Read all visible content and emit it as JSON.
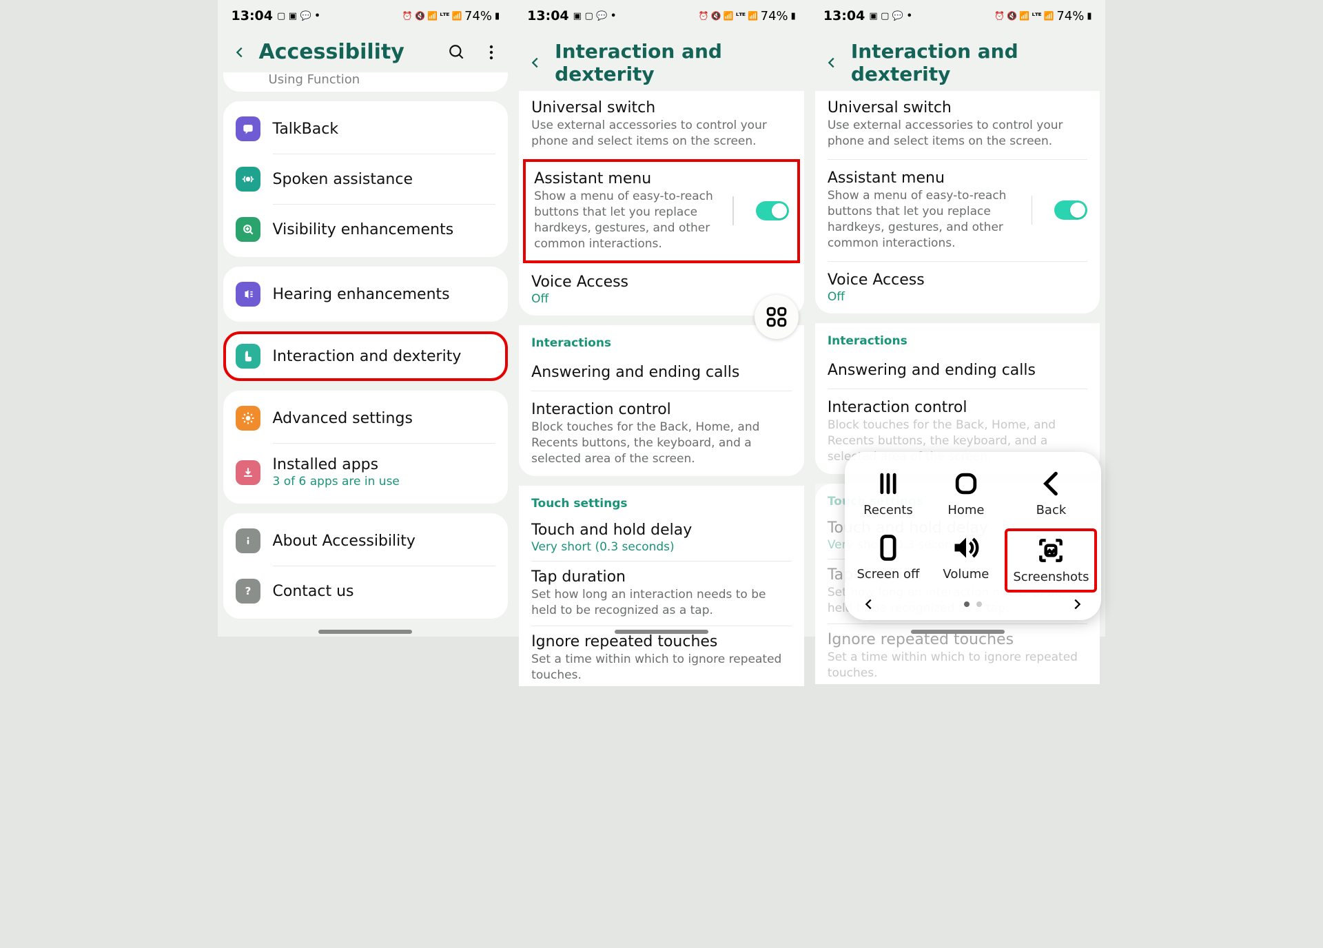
{
  "status": {
    "time": "13:04",
    "battery_text": "74%"
  },
  "colors": {
    "accent": "#136356",
    "toggle_on": "#2bd4b0",
    "highlight": "#e60000"
  },
  "screens": [
    {
      "title": "Accessibility",
      "peek_text": "Using Function",
      "groups": [
        {
          "items": [
            {
              "icon_color": "#6f5bd4",
              "icon": "chat",
              "title": "TalkBack"
            },
            {
              "icon_color": "#1fa38f",
              "icon": "voice",
              "title": "Spoken assistance"
            },
            {
              "icon_color": "#2ba36c",
              "icon": "zoom",
              "title": "Visibility enhancements"
            }
          ]
        },
        {
          "items": [
            {
              "icon_color": "#6f5bd4",
              "icon": "hear",
              "title": "Hearing enhancements"
            }
          ]
        },
        {
          "items": [
            {
              "icon_color": "#2bb29a",
              "icon": "touch",
              "title": "Interaction and dexterity",
              "highlighted": true
            }
          ]
        },
        {
          "items": [
            {
              "icon_color": "#f08c2b",
              "icon": "gear",
              "title": "Advanced settings"
            },
            {
              "icon_color": "#e06a7b",
              "icon": "download",
              "title": "Installed apps",
              "sub_green": "3 of 6 apps are in use"
            }
          ]
        },
        {
          "items": [
            {
              "icon_color": "#8b8f8c",
              "icon": "info",
              "title": "About Accessibility"
            },
            {
              "icon_color": "#8b8f8c",
              "icon": "help",
              "title": "Contact us"
            }
          ]
        }
      ]
    },
    {
      "title": "Interaction and dexterity",
      "sections": [
        {
          "kind": "group",
          "items": [
            {
              "title": "Universal switch",
              "sub": "Use external accessories to control your phone and select items on the screen."
            },
            {
              "title": "Assistant menu",
              "sub": "Show a menu of easy-to-reach buttons that let you replace hardkeys, gestures, and other common interactions.",
              "toggle": true,
              "highlighted": true
            },
            {
              "title": "Voice Access",
              "sub_green": "Off"
            }
          ]
        },
        {
          "kind": "header",
          "label": "Interactions"
        },
        {
          "kind": "group",
          "items": [
            {
              "title": "Answering and ending calls"
            },
            {
              "title": "Interaction control",
              "sub": "Block touches for the Back, Home, and Recents buttons, the keyboard, and a selected area of the screen."
            }
          ]
        },
        {
          "kind": "header",
          "label": "Touch settings"
        },
        {
          "kind": "group",
          "items": [
            {
              "title": "Touch and hold delay",
              "sub_green": "Very short (0.3 seconds)"
            },
            {
              "title": "Tap duration",
              "sub": "Set how long an interaction needs to be held to be recognized as a tap."
            },
            {
              "title": "Ignore repeated touches",
              "sub": "Set a time within which to ignore repeated touches."
            }
          ]
        }
      ],
      "floating_button": true
    },
    {
      "title": "Interaction and dexterity",
      "sections": [
        {
          "kind": "group",
          "items": [
            {
              "title": "Universal switch",
              "sub": "Use external accessories to control your phone and select items on the screen."
            },
            {
              "title": "Assistant menu",
              "sub": "Show a menu of easy-to-reach buttons that let you replace hardkeys, gestures, and other common interactions.",
              "toggle": true
            },
            {
              "title": "Voice Access",
              "sub_green": "Off"
            }
          ]
        },
        {
          "kind": "header",
          "label": "Interactions"
        },
        {
          "kind": "group",
          "items": [
            {
              "title": "Answering and ending calls"
            },
            {
              "title": "Interaction control",
              "sub": "Block touches for the Back, Home, and Recents buttons, the keyboard, and a selected area of the screen."
            }
          ]
        },
        {
          "kind": "header",
          "label": "Touch settings"
        },
        {
          "kind": "group",
          "items": [
            {
              "title": "Touch and hold delay",
              "sub_green": "Very short (0.3 seconds)"
            },
            {
              "title": "Tap duration",
              "sub": "Set how long an interaction needs to be held to be recognized as a tap."
            },
            {
              "title": "Ignore repeated touches",
              "sub": "Set a time within which to ignore repeated touches."
            }
          ]
        }
      ],
      "assistant_panel": {
        "items": [
          {
            "label": "Recents",
            "icon": "recents"
          },
          {
            "label": "Home",
            "icon": "home"
          },
          {
            "label": "Back",
            "icon": "back"
          },
          {
            "label": "Screen off",
            "icon": "screenoff"
          },
          {
            "label": "Volume",
            "icon": "volume"
          },
          {
            "label": "Screenshots",
            "icon": "screenshot",
            "highlighted": true
          }
        ]
      }
    }
  ]
}
